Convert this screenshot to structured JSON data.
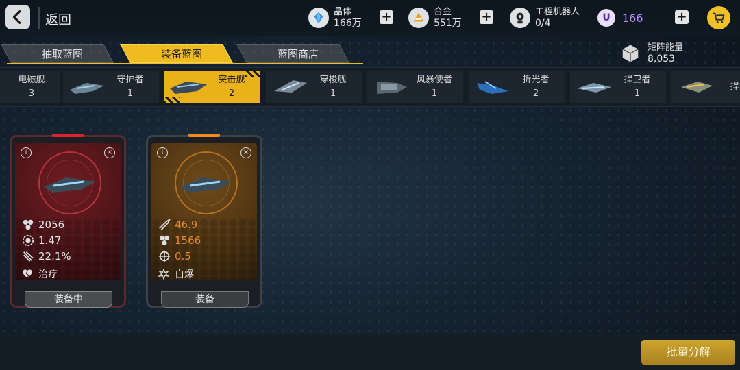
{
  "header": {
    "back_label": "返回",
    "resources": [
      {
        "name": "晶体",
        "value": "166万",
        "icon": "crystal-icon"
      },
      {
        "name": "合金",
        "value": "551万",
        "icon": "alloy-icon"
      },
      {
        "name": "工程机器人",
        "value": "0/4",
        "icon": "robot-icon"
      }
    ],
    "premium": {
      "value": "166",
      "icon": "u-coin-icon",
      "color": "#b78bff"
    }
  },
  "tabs": [
    {
      "label": "抽取蓝图",
      "active": false
    },
    {
      "label": "装备蓝图",
      "active": true
    },
    {
      "label": "蓝图商店",
      "active": false
    }
  ],
  "matrix_energy": {
    "name": "矩阵能量",
    "value": "8,053"
  },
  "ships": [
    {
      "name": "电磁舰",
      "count": "3"
    },
    {
      "name": "守护者",
      "count": "1"
    },
    {
      "name": "突击舰",
      "count": "2",
      "active": true
    },
    {
      "name": "穿梭舰",
      "count": "1"
    },
    {
      "name": "风暴使者",
      "count": "1"
    },
    {
      "name": "折光者",
      "count": "2"
    },
    {
      "name": "捍卫者",
      "count": "1"
    },
    {
      "name": "捍"
    }
  ],
  "cards": [
    {
      "rarity": "red",
      "stats": [
        {
          "icon": "cluster-icon",
          "value": "2056"
        },
        {
          "icon": "gear-ring-icon",
          "value": "1.47"
        },
        {
          "icon": "claw-icon",
          "value": "22.1%"
        }
      ],
      "ability": {
        "icon": "broken-heart-icon",
        "label": "治疗"
      },
      "button": "装备中"
    },
    {
      "rarity": "gold",
      "stats": [
        {
          "icon": "missile-icon",
          "value": "46.9"
        },
        {
          "icon": "cluster-icon",
          "value": "1566"
        },
        {
          "icon": "crosshair-icon",
          "value": "0.5"
        }
      ],
      "ability": {
        "icon": "explosion-icon",
        "label": "自爆"
      },
      "button": "装备"
    }
  ],
  "bulk_button": "批量分解",
  "colors": {
    "accent": "#f0bb1e",
    "stat_orange": "#e58a2c",
    "red_glow": "#e0212a",
    "gold_glow": "#f08a1c"
  }
}
